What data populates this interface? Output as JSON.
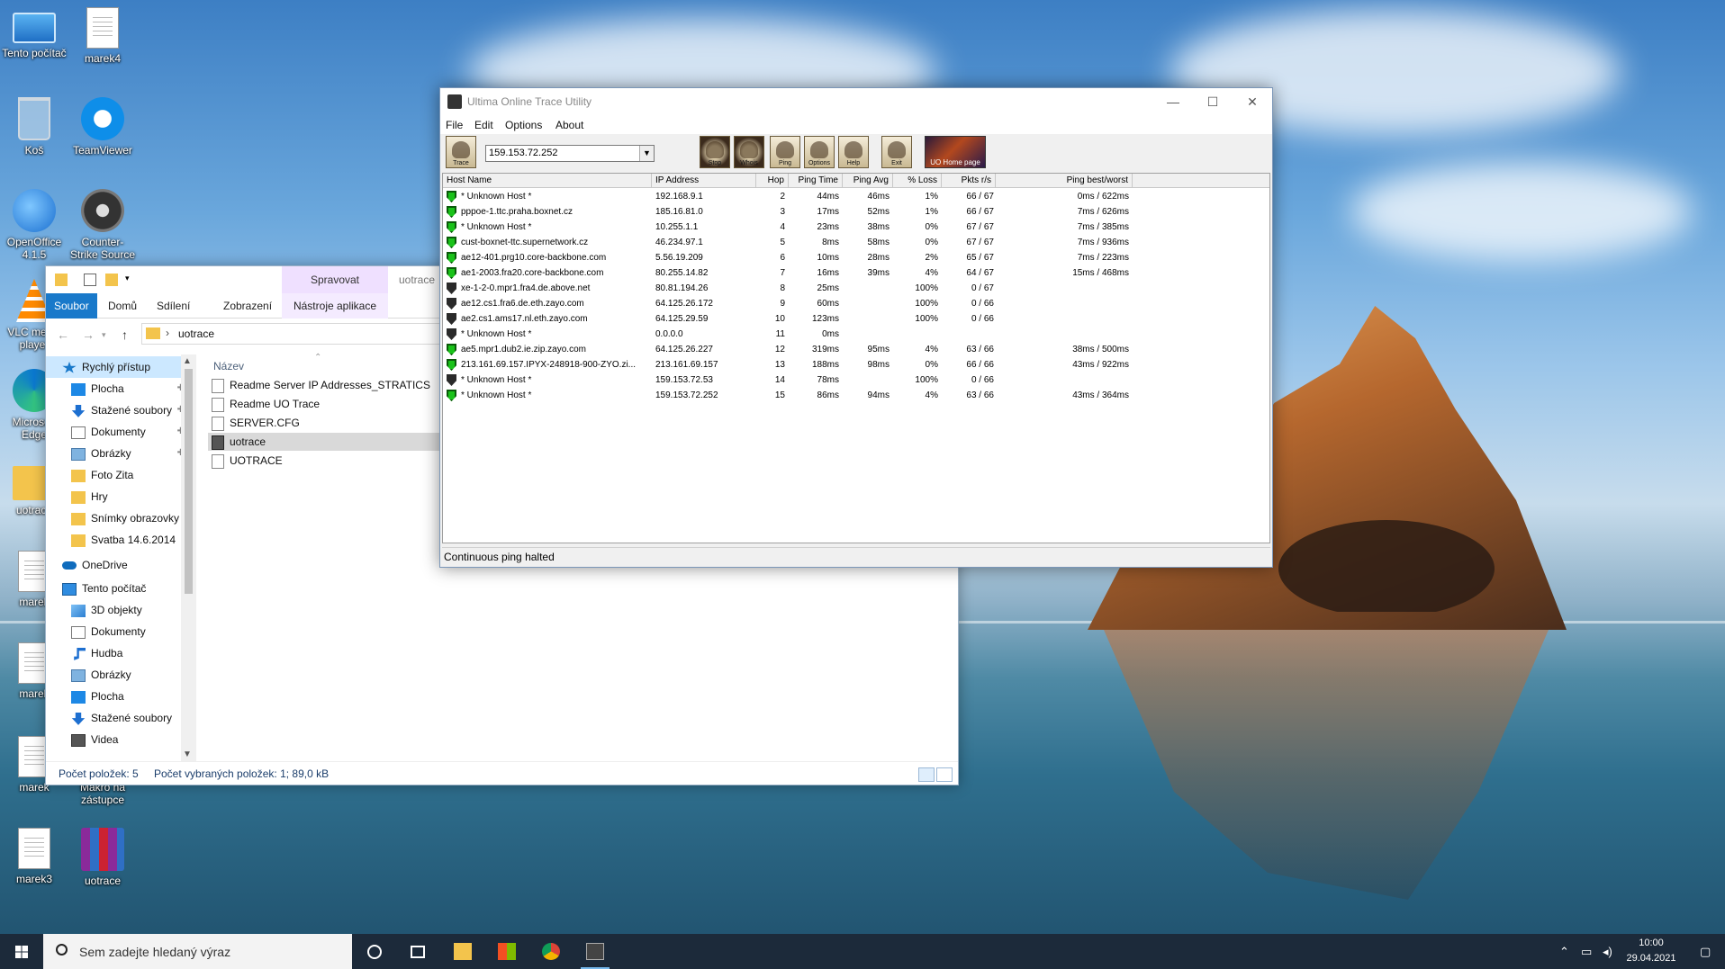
{
  "desktop": {
    "icons": [
      {
        "label": "Tento počítač",
        "icon": "computer-icon"
      },
      {
        "label": "marek4",
        "icon": "document-icon"
      },
      {
        "label": "Koš",
        "icon": "recycle-bin-icon"
      },
      {
        "label": "TeamViewer",
        "icon": "teamviewer-icon"
      },
      {
        "label": "OpenOffice 4.1.5",
        "icon": "openoffice-icon"
      },
      {
        "label": "Counter-Strike Source",
        "icon": "counter-strike-icon"
      },
      {
        "label": "VLC media player",
        "icon": "vlc-icon"
      },
      {
        "label": "Microsoft Edge",
        "icon": "edge-icon"
      },
      {
        "label": "uotrace",
        "icon": "folder-icon"
      },
      {
        "label": "marek",
        "icon": "document-icon"
      },
      {
        "label": "marek",
        "icon": "document-icon"
      },
      {
        "label": "marek",
        "icon": "document-icon"
      },
      {
        "label": "Makro na zástupce",
        "icon": "document-icon"
      },
      {
        "label": "marek3",
        "icon": "document-icon"
      },
      {
        "label": "uotrace",
        "icon": "winrar-icon"
      }
    ]
  },
  "explorer": {
    "context_group": "Spravovat",
    "window_title": "uotrace",
    "tabs": [
      "Soubor",
      "Domů",
      "Sdílení",
      "Zobrazení",
      "Nástroje aplikace"
    ],
    "address": {
      "separator": "›",
      "path": "uotrace"
    },
    "sidebar": [
      {
        "label": "Rychlý přístup",
        "icon": "star-icon",
        "pinned": false,
        "level": 0,
        "selected": true
      },
      {
        "label": "Plocha",
        "icon": "desktop-icon",
        "pinned": true,
        "level": 1
      },
      {
        "label": "Stažené soubory",
        "icon": "download-icon",
        "pinned": true,
        "level": 1
      },
      {
        "label": "Dokumenty",
        "icon": "documents-icon",
        "pinned": true,
        "level": 1
      },
      {
        "label": "Obrázky",
        "icon": "pictures-icon",
        "pinned": true,
        "level": 1
      },
      {
        "label": "Foto Zita",
        "icon": "folder-icon",
        "pinned": false,
        "level": 1
      },
      {
        "label": "Hry",
        "icon": "folder-icon",
        "pinned": false,
        "level": 1
      },
      {
        "label": "Snímky obrazovky",
        "icon": "folder-icon",
        "pinned": false,
        "level": 1
      },
      {
        "label": "Svatba 14.6.2014",
        "icon": "folder-icon",
        "pinned": false,
        "level": 1
      },
      {
        "label": "OneDrive",
        "icon": "cloud-icon",
        "pinned": false,
        "level": 0
      },
      {
        "label": "Tento počítač",
        "icon": "computer-icon",
        "pinned": false,
        "level": 0
      },
      {
        "label": "3D objekty",
        "icon": "cube-icon",
        "pinned": false,
        "level": 1
      },
      {
        "label": "Dokumenty",
        "icon": "documents-icon",
        "pinned": false,
        "level": 1
      },
      {
        "label": "Hudba",
        "icon": "music-icon",
        "pinned": false,
        "level": 1
      },
      {
        "label": "Obrázky",
        "icon": "pictures-icon",
        "pinned": false,
        "level": 1
      },
      {
        "label": "Plocha",
        "icon": "desktop-icon",
        "pinned": false,
        "level": 1
      },
      {
        "label": "Stažené soubory",
        "icon": "download-icon",
        "pinned": false,
        "level": 1
      },
      {
        "label": "Videa",
        "icon": "video-icon",
        "pinned": false,
        "level": 1
      }
    ],
    "column_header": "Název",
    "files": [
      {
        "name": "Readme Server IP Addresses_STRATICS",
        "type": "text",
        "selected": false
      },
      {
        "name": "Readme UO Trace",
        "type": "text",
        "selected": false
      },
      {
        "name": "SERVER.CFG",
        "type": "text",
        "selected": false
      },
      {
        "name": "uotrace",
        "type": "app",
        "selected": true
      },
      {
        "name": "UOTRACE",
        "type": "text",
        "selected": false
      }
    ],
    "status_count": "Počet položek: 5",
    "status_selected": "Počet vybraných položek: 1; 89,0 kB"
  },
  "trace": {
    "title": "Ultima Online Trace Utility",
    "menu": [
      "File",
      "Edit",
      "Options",
      "About"
    ],
    "host_value": "159.153.72.252",
    "toolbar_buttons": [
      "Trace",
      "Stop",
      "Whois",
      "Ping",
      "Options",
      "Help",
      "Exit"
    ],
    "home_button": "UO Home page",
    "columns": [
      "Host Name",
      "IP Address",
      "Hop",
      "Ping Time",
      "Ping Avg",
      "% Loss",
      "Pkts r/s",
      "Ping best/worst"
    ],
    "rows": [
      {
        "status": "ok",
        "host": "* Unknown Host *",
        "ip": "192.168.9.1",
        "hop": "2",
        "time": "44ms",
        "avg": "46ms",
        "loss": "1%",
        "pkts": "66 / 67",
        "bw": "0ms / 622ms"
      },
      {
        "status": "ok",
        "host": "pppoe-1.ttc.praha.boxnet.cz",
        "ip": "185.16.81.0",
        "hop": "3",
        "time": "17ms",
        "avg": "52ms",
        "loss": "1%",
        "pkts": "66 / 67",
        "bw": "7ms / 626ms"
      },
      {
        "status": "ok",
        "host": "* Unknown Host *",
        "ip": "10.255.1.1",
        "hop": "4",
        "time": "23ms",
        "avg": "38ms",
        "loss": "0%",
        "pkts": "67 / 67",
        "bw": "7ms / 385ms"
      },
      {
        "status": "ok",
        "host": "cust-boxnet-ttc.supernetwork.cz",
        "ip": "46.234.97.1",
        "hop": "5",
        "time": "8ms",
        "avg": "58ms",
        "loss": "0%",
        "pkts": "67 / 67",
        "bw": "7ms / 936ms"
      },
      {
        "status": "ok",
        "host": "ae12-401.prg10.core-backbone.com",
        "ip": "5.56.19.209",
        "hop": "6",
        "time": "10ms",
        "avg": "28ms",
        "loss": "2%",
        "pkts": "65 / 67",
        "bw": "7ms / 223ms"
      },
      {
        "status": "ok",
        "host": "ae1-2003.fra20.core-backbone.com",
        "ip": "80.255.14.82",
        "hop": "7",
        "time": "16ms",
        "avg": "39ms",
        "loss": "4%",
        "pkts": "64 / 67",
        "bw": "15ms / 468ms"
      },
      {
        "status": "bad",
        "host": "xe-1-2-0.mpr1.fra4.de.above.net",
        "ip": "80.81.194.26",
        "hop": "8",
        "time": "25ms",
        "avg": "",
        "loss": "100%",
        "pkts": "0 / 67",
        "bw": ""
      },
      {
        "status": "bad",
        "host": "ae12.cs1.fra6.de.eth.zayo.com",
        "ip": "64.125.26.172",
        "hop": "9",
        "time": "60ms",
        "avg": "",
        "loss": "100%",
        "pkts": "0 / 66",
        "bw": ""
      },
      {
        "status": "bad",
        "host": "ae2.cs1.ams17.nl.eth.zayo.com",
        "ip": "64.125.29.59",
        "hop": "10",
        "time": "123ms",
        "avg": "",
        "loss": "100%",
        "pkts": "0 / 66",
        "bw": ""
      },
      {
        "status": "bad",
        "host": "* Unknown Host *",
        "ip": "0.0.0.0",
        "hop": "11",
        "time": "0ms",
        "avg": "",
        "loss": "",
        "pkts": "",
        "bw": ""
      },
      {
        "status": "ok",
        "host": "ae5.mpr1.dub2.ie.zip.zayo.com",
        "ip": "64.125.26.227",
        "hop": "12",
        "time": "319ms",
        "avg": "95ms",
        "loss": "4%",
        "pkts": "63 / 66",
        "bw": "38ms / 500ms"
      },
      {
        "status": "ok",
        "host": "213.161.69.157.IPYX-248918-900-ZYO.zi...",
        "ip": "213.161.69.157",
        "hop": "13",
        "time": "188ms",
        "avg": "98ms",
        "loss": "0%",
        "pkts": "66 / 66",
        "bw": "43ms / 922ms"
      },
      {
        "status": "bad",
        "host": "* Unknown Host *",
        "ip": "159.153.72.53",
        "hop": "14",
        "time": "78ms",
        "avg": "",
        "loss": "100%",
        "pkts": "0 / 66",
        "bw": ""
      },
      {
        "status": "ok",
        "host": "* Unknown Host *",
        "ip": "159.153.72.252",
        "hop": "15",
        "time": "86ms",
        "avg": "94ms",
        "loss": "4%",
        "pkts": "63 / 66",
        "bw": "43ms / 364ms"
      }
    ],
    "status": "Continuous ping halted"
  },
  "taskbar": {
    "search_placeholder": "Sem zadejte hledaný výraz",
    "apps": [
      "cortana-icon",
      "task-view-icon",
      "file-explorer-icon",
      "store-icon",
      "chrome-icon",
      "uotrace-icon"
    ],
    "time": "10:00",
    "date": "29.04.2021"
  },
  "colors": {
    "taskbar": "#1c2a3a",
    "ok_shield": "#19c219",
    "explorer_file_tab": "#1979ca",
    "selection": "#cce8ff"
  }
}
